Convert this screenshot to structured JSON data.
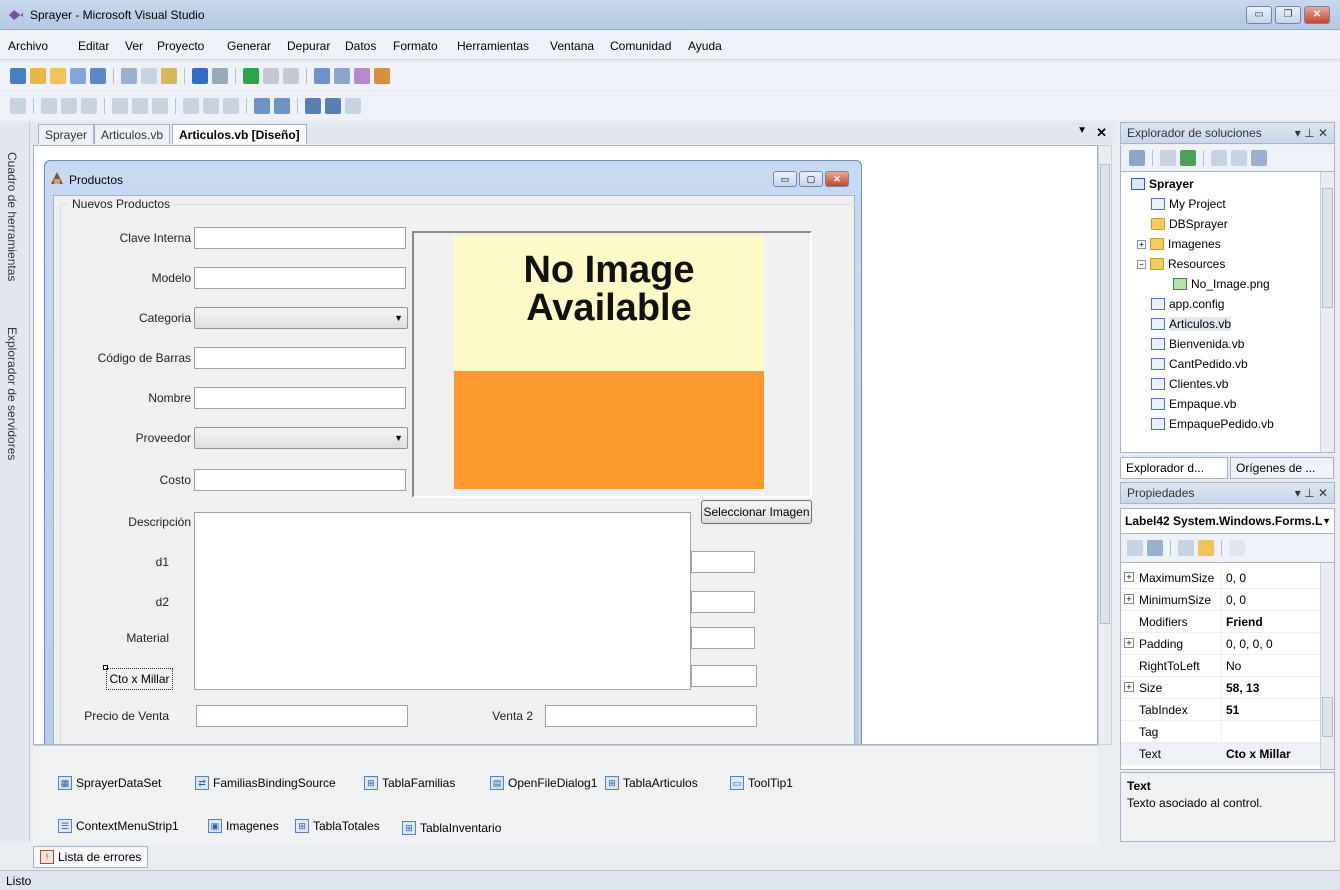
{
  "window": {
    "title": "Sprayer - Microsoft Visual Studio",
    "minimize": "▭",
    "maximize": "❐",
    "close": "✕"
  },
  "menu": [
    "Archivo",
    "Editar",
    "Ver",
    "Proyecto",
    "Generar",
    "Depurar",
    "Datos",
    "Formato",
    "Herramientas",
    "Ventana",
    "Comunidad",
    "Ayuda"
  ],
  "side_strip": {
    "toolbox": "Cuadro de herramientas",
    "server_explorer": "Explorador de servidores"
  },
  "doc_tabs": {
    "tab1": "Sprayer",
    "tab2": "Articulos.vb",
    "tab3": "Articulos.vb [Diseño]",
    "close": "✕",
    "dropdown": "▼"
  },
  "form": {
    "title": "Productos",
    "group_title": "Nuevos Productos",
    "labels": {
      "clave": "Clave Interna",
      "modelo": "Modelo",
      "categoria": "Categoria",
      "codigo": "Código de Barras",
      "nombre": "Nombre",
      "proveedor": "Proveedor",
      "costo": "Costo",
      "descripcion": "Descripción",
      "d1": "d1",
      "d2": "d2",
      "material": "Material",
      "cto_millar": "Cto x Millar",
      "precio_venta": "Precio de Venta",
      "venta2": "Venta 2"
    },
    "no_image_line1": "No Image",
    "no_image_line2": "Available",
    "select_image_button": "Seleccionar Imagen"
  },
  "tray": [
    {
      "label": "SprayerDataSet",
      "icon": "dataset-icon"
    },
    {
      "label": "FamiliasBindingSource",
      "icon": "binding-source-icon"
    },
    {
      "label": "TablaFamilias",
      "icon": "table-adapter-icon"
    },
    {
      "label": "OpenFileDialog1",
      "icon": "open-file-dialog-icon"
    },
    {
      "label": "TablaArticulos",
      "icon": "table-adapter-icon"
    },
    {
      "label": "ToolTip1",
      "icon": "tooltip-icon"
    },
    {
      "label": "ContextMenuStrip1",
      "icon": "context-menu-icon"
    },
    {
      "label": "Imagenes",
      "icon": "imagelist-icon"
    },
    {
      "label": "TablaTotales",
      "icon": "table-adapter-icon"
    },
    {
      "label": "TablaInventario",
      "icon": "table-adapter-icon"
    }
  ],
  "error_list_tab": "Lista de errores",
  "status": "Listo",
  "solution_explorer": {
    "title": "Explorador de soluciones",
    "controls": "▾ ⊥ ✕",
    "tree": {
      "root": "Sprayer",
      "my_project": "My Project",
      "dbsprayer": "DBSprayer",
      "imagenes": "Imagenes",
      "resources": "Resources",
      "no_image": "No_Image.png",
      "app_config": "app.config",
      "articulos": "Articulos.vb",
      "bienvenida": "Bienvenida.vb",
      "cantpedido": "CantPedido.vb",
      "clientes": "Clientes.vb",
      "empaque": "Empaque.vb",
      "empaquepedido": "EmpaquePedido.vb"
    },
    "tab1": "Explorador d...",
    "tab2": "Orígenes de ..."
  },
  "properties": {
    "title": "Propiedades",
    "controls": "▾ ⊥ ✕",
    "object": "Label42 System.Windows.Forms.L",
    "rows": [
      {
        "name": "MaximumSize",
        "value": "0, 0",
        "expandable": true,
        "bold": false
      },
      {
        "name": "MinimumSize",
        "value": "0, 0",
        "expandable": true,
        "bold": false
      },
      {
        "name": "Modifiers",
        "value": "Friend",
        "expandable": false,
        "bold": true
      },
      {
        "name": "Padding",
        "value": "0, 0, 0, 0",
        "expandable": true,
        "bold": false
      },
      {
        "name": "RightToLeft",
        "value": "No",
        "expandable": false,
        "bold": false
      },
      {
        "name": "Size",
        "value": "58, 13",
        "expandable": true,
        "bold": true
      },
      {
        "name": "TabIndex",
        "value": "51",
        "expandable": false,
        "bold": true
      },
      {
        "name": "Tag",
        "value": "",
        "expandable": false,
        "bold": false
      },
      {
        "name": "Text",
        "value": "Cto x Millar",
        "expandable": false,
        "bold": true
      }
    ],
    "desc_title": "Text",
    "desc_text": "Texto asociado al control."
  },
  "colors": {
    "image_bg": "#fefac8",
    "image_orange": "#fb992e",
    "accent": "#2f5fa8"
  }
}
